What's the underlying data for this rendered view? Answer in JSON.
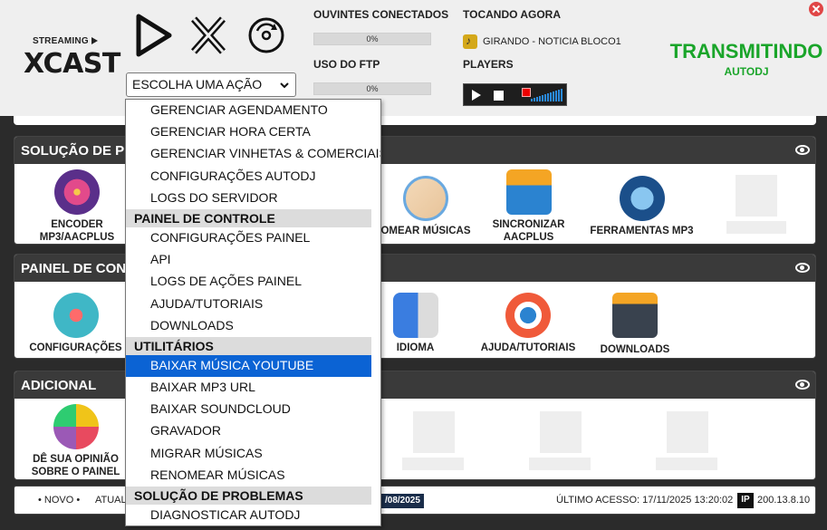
{
  "header": {
    "logo_top": "STREAMING",
    "logo_main": "XCAST",
    "action_select": {
      "selected": "ESCOLHA UMA AÇÃO"
    },
    "listeners": {
      "label": "OUVINTES CONECTADOS",
      "progress": 0,
      "progress_text": "0%"
    },
    "ftp": {
      "label": "USO DO FTP",
      "progress": 0,
      "progress_text": "0%"
    },
    "now_playing": {
      "label": "TOCANDO AGORA",
      "track": "GIRANDO - NOTICIA BLOCO1"
    },
    "players_label": "PLAYERS",
    "status": {
      "main": "TRANSMITINDO",
      "sub": "AUTODJ",
      "color": "#1aa52a"
    }
  },
  "panels": [
    {
      "title": "SOLUÇÃO DE PRO",
      "tiles": [
        {
          "label": "ENCODER MP3/AACPLUS",
          "icon": "vinyl-icon"
        },
        {
          "label": "OMEAR MÚSICAS",
          "icon": "notepad-icon"
        },
        {
          "label": "SINCRONIZAR AACPLUS",
          "icon": "sync-monitor-icon"
        },
        {
          "label": "FERRAMENTAS MP3",
          "icon": "mp3-player-icon"
        }
      ]
    },
    {
      "title": "PAINEL DE CONT",
      "tiles": [
        {
          "label": "CONFIGURAÇÕES",
          "icon": "gears-icon"
        },
        {
          "label": "IDIOMA",
          "icon": "translate-icon"
        },
        {
          "label": "AJUDA/TUTORIAIS",
          "icon": "lifebuoy-icon"
        },
        {
          "label": "DOWNLOADS",
          "icon": "download-window-icon"
        }
      ]
    },
    {
      "title": "ADICIONAL",
      "tiles": [
        {
          "label": "DÊ SUA OPINIÃO SOBRE O PAINEL",
          "icon": "feedback-faces-icon"
        }
      ]
    }
  ],
  "dropdown": {
    "items": [
      {
        "type": "item",
        "label": "GERENCIAR AGENDAMENTO"
      },
      {
        "type": "item",
        "label": "GERENCIAR HORA CERTA"
      },
      {
        "type": "item",
        "label": "GERENCIAR VINHETAS & COMERCIAIS"
      },
      {
        "type": "item",
        "label": "CONFIGURAÇÕES AUTODJ"
      },
      {
        "type": "item",
        "label": "LOGS DO SERVIDOR"
      },
      {
        "type": "group",
        "label": "PAINEL DE CONTROLE"
      },
      {
        "type": "item",
        "label": "CONFIGURAÇÕES PAINEL"
      },
      {
        "type": "item",
        "label": "API"
      },
      {
        "type": "item",
        "label": "LOGS DE AÇÕES PAINEL"
      },
      {
        "type": "item",
        "label": "AJUDA/TUTORIAIS"
      },
      {
        "type": "item",
        "label": "DOWNLOADS"
      },
      {
        "type": "group",
        "label": "UTILITÁRIOS"
      },
      {
        "type": "item",
        "label": "BAIXAR MÚSICA YOUTUBE",
        "active": true
      },
      {
        "type": "item",
        "label": "BAIXAR MP3 URL"
      },
      {
        "type": "item",
        "label": "BAIXAR SOUNDCLOUD"
      },
      {
        "type": "item",
        "label": "GRAVADOR"
      },
      {
        "type": "item",
        "label": "MIGRAR MÚSICAS"
      },
      {
        "type": "item",
        "label": "RENOMEAR MÚSICAS"
      },
      {
        "type": "group",
        "label": "SOLUÇÃO DE PROBLEMAS"
      },
      {
        "type": "item",
        "label": "DIAGNOSTICAR AUTODJ"
      }
    ]
  },
  "footer": {
    "new_label": "NOVO",
    "update_label": "ATUAL",
    "date": "/08/2025",
    "last_access": "ÚLTIMO ACESSO: 17/11/2025 13:20:02",
    "ip_badge": "IP",
    "ip": "200.13.8.10"
  },
  "colors": {
    "accent": "#0b63d4",
    "header_bg": "#efefef",
    "panel_header": "#3a3a3a"
  }
}
